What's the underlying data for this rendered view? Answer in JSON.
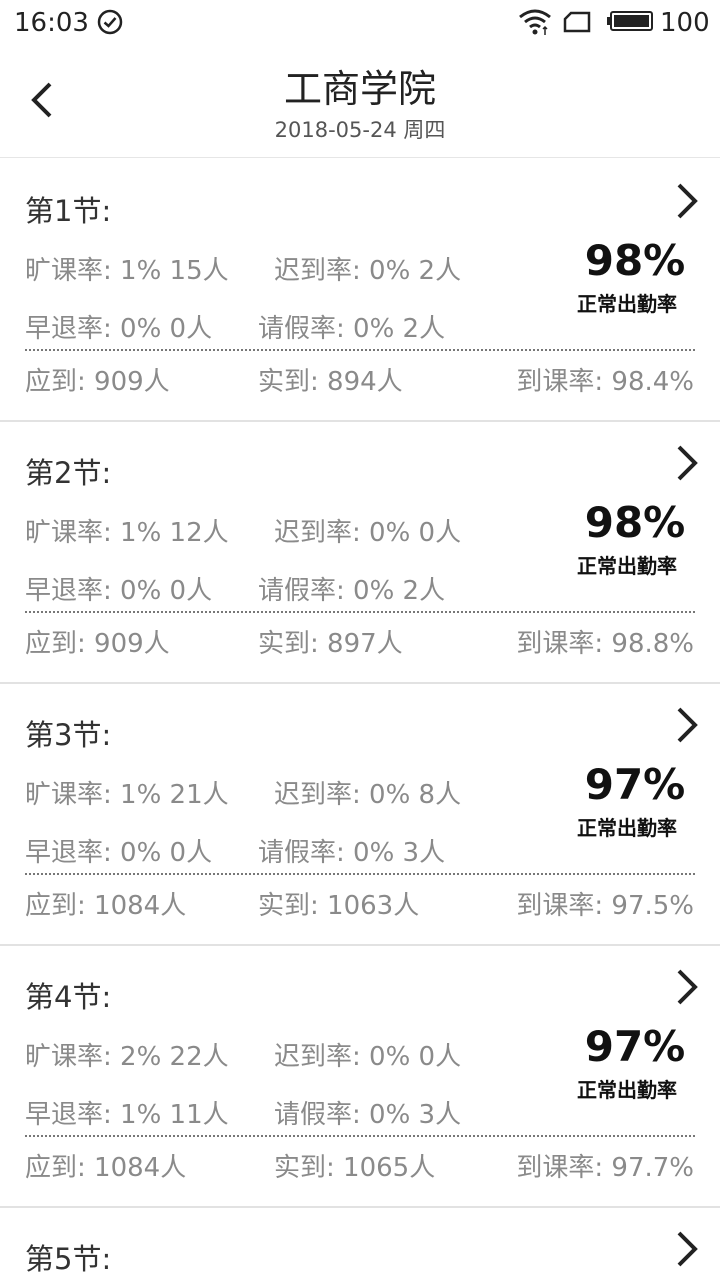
{
  "status": {
    "time": "16:03",
    "battery": "100"
  },
  "header": {
    "title": "工商学院",
    "subtitle": "2018-05-24 周四"
  },
  "sessions": [
    {
      "title": "第1节:",
      "absent": "旷课率: 1%  15人",
      "late": "迟到率: 0%  2人",
      "early": "早退率: 0%  0人",
      "leave": "请假率: 0%  2人",
      "percent": "98%",
      "percent_label": "正常出勤率",
      "expected": "应到: 909人",
      "actual": "实到: 894人",
      "rate": "到课率: 98.4%"
    },
    {
      "title": "第2节:",
      "absent": "旷课率: 1%  12人",
      "late": "迟到率: 0%  0人",
      "early": "早退率: 0%  0人",
      "leave": "请假率: 0%  2人",
      "percent": "98%",
      "percent_label": "正常出勤率",
      "expected": "应到: 909人",
      "actual": "实到: 897人",
      "rate": "到课率: 98.8%"
    },
    {
      "title": "第3节:",
      "absent": "旷课率: 1%  21人",
      "late": "迟到率: 0%  8人",
      "early": "早退率: 0%  0人",
      "leave": "请假率: 0%  3人",
      "percent": "97%",
      "percent_label": "正常出勤率",
      "expected": "应到: 1084人",
      "actual": "实到: 1063人",
      "rate": "到课率: 97.5%"
    },
    {
      "title": "第4节:",
      "absent": "旷课率: 2%  22人",
      "late": "迟到率: 0%  0人",
      "early": "早退率: 1%  11人",
      "leave": "请假率: 0%  3人",
      "percent": "97%",
      "percent_label": "正常出勤率",
      "expected": "应到: 1084人",
      "actual": "实到: 1065人",
      "rate": "到课率: 97.7%"
    },
    {
      "title": "第5节:"
    }
  ]
}
